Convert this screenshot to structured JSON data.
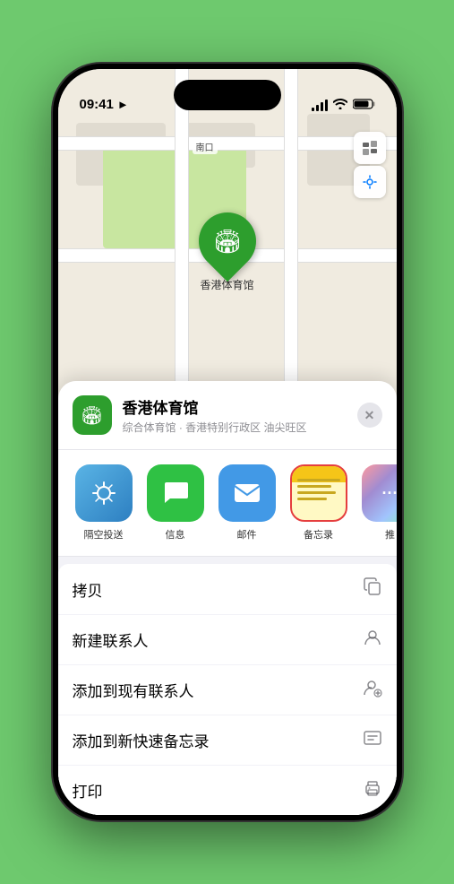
{
  "status_bar": {
    "time": "09:41",
    "location_icon": "▶"
  },
  "map": {
    "label_south_gate": "南口"
  },
  "venue": {
    "name": "香港体育馆",
    "subtitle": "综合体育馆 · 香港特别行政区 油尖旺区",
    "pin_label": "香港体育馆"
  },
  "share_items": [
    {
      "id": "airdrop",
      "label": "隔空投送",
      "icon": "📡"
    },
    {
      "id": "message",
      "label": "信息",
      "icon": "💬"
    },
    {
      "id": "mail",
      "label": "邮件",
      "icon": "✉️"
    },
    {
      "id": "notes",
      "label": "备忘录",
      "icon": "📝"
    },
    {
      "id": "more",
      "label": "推",
      "icon": "⋯"
    }
  ],
  "actions": [
    {
      "id": "copy",
      "label": "拷贝",
      "icon": "⊡"
    },
    {
      "id": "new-contact",
      "label": "新建联系人",
      "icon": "👤"
    },
    {
      "id": "add-existing",
      "label": "添加到现有联系人",
      "icon": "👤+"
    },
    {
      "id": "quick-note",
      "label": "添加到新快速备忘录",
      "icon": "⊞"
    },
    {
      "id": "print",
      "label": "打印",
      "icon": "🖨"
    }
  ],
  "close_label": "✕"
}
